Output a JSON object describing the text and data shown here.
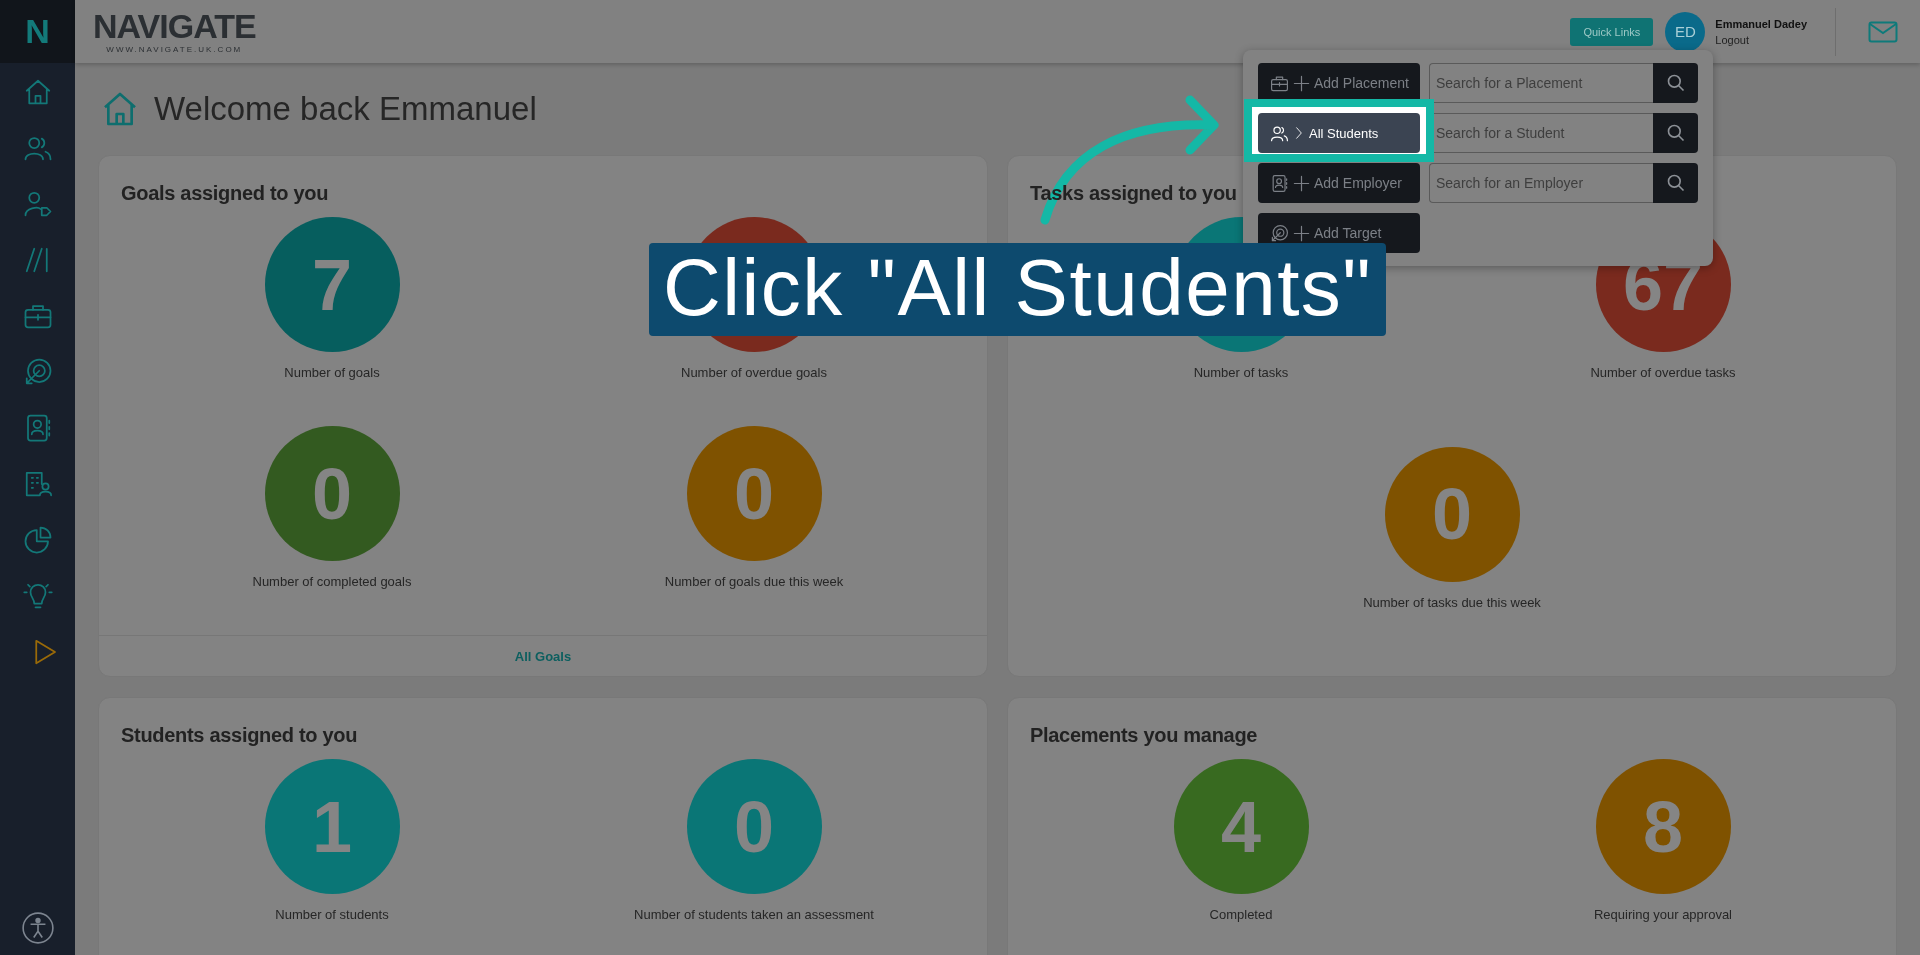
{
  "brand": {
    "badge": "N",
    "name": "NAVIGATE",
    "tagline": "WWW.NAVIGATE.UK.COM"
  },
  "header": {
    "quick_links": "Quick Links",
    "user": {
      "initials": "ED",
      "name": "Emmanuel Dadey",
      "logout": "Logout"
    }
  },
  "page_title": "Welcome back Emmanuel",
  "cards": [
    {
      "title": "Goals assigned to you",
      "stats": [
        {
          "value": "7",
          "label": "Number of goals",
          "color": "#065e5e"
        },
        {
          "label": "Number of overdue goals",
          "color": "#7a2a1e"
        },
        {
          "value": "0",
          "label": "Number of completed goals",
          "color": "#335a20"
        },
        {
          "value": "0",
          "label": "Number of goals due this week",
          "color": "#7f5200"
        }
      ],
      "footer_link": "All Goals"
    },
    {
      "title": "Tasks assigned to you",
      "stats": [
        {
          "label": "Number of tasks",
          "color": "#0a7676"
        },
        {
          "value": "67",
          "label": "Number of overdue tasks",
          "color": "#7a2a1e"
        },
        {
          "value": "0",
          "label": "Number of tasks due this week",
          "color": "#7f5200"
        }
      ]
    },
    {
      "title": "Students assigned to you",
      "stats": [
        {
          "value": "1",
          "label": "Number of students",
          "color": "#0a7676"
        },
        {
          "value": "0",
          "label": "Number of students taken an assessment",
          "color": "#0a7676"
        }
      ]
    },
    {
      "title": "Placements you manage",
      "stats": [
        {
          "value": "4",
          "label": "Completed",
          "color": "#386a20"
        },
        {
          "value": "8",
          "label": "Requiring your approval",
          "color": "#7f5200"
        }
      ]
    }
  ],
  "quick_links_menu": {
    "actions": [
      {
        "label": "Add Placement",
        "kind": "add",
        "selected": false
      },
      {
        "label": "All Students",
        "kind": "nav",
        "selected": true
      },
      {
        "label": "Add Employer",
        "kind": "add",
        "selected": false
      },
      {
        "label": "Add Target",
        "kind": "add",
        "selected": false
      }
    ],
    "searches": [
      {
        "placeholder": "Search for a Placement"
      },
      {
        "placeholder": "Search for a Student"
      },
      {
        "placeholder": "Search for an Employer"
      }
    ]
  },
  "tutorial": {
    "caption": "Click \"All Students\""
  }
}
